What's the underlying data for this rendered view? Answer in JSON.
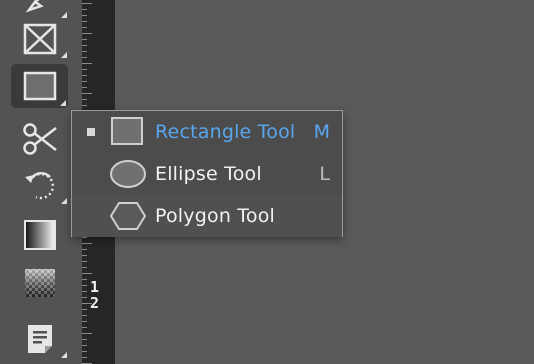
{
  "toolbar": {
    "tools": [
      {
        "name": "pen-tool",
        "icon": "pen-icon"
      },
      {
        "name": "rectangle-frame-tool",
        "icon": "frame-x-icon"
      },
      {
        "name": "rectangle-tool",
        "icon": "rectangle-icon",
        "selected": true
      },
      {
        "name": "scissors-tool",
        "icon": "scissors-icon"
      },
      {
        "name": "free-transform-tool",
        "icon": "rotate-icon"
      },
      {
        "name": "gradient-swatch-tool",
        "icon": "gradient-icon"
      },
      {
        "name": "gradient-feather-tool",
        "icon": "checker-icon"
      },
      {
        "name": "note-tool",
        "icon": "note-icon"
      }
    ]
  },
  "ruler": {
    "label_line1": "1",
    "label_line2": "2"
  },
  "flyout": {
    "items": [
      {
        "label": "Rectangle Tool",
        "shortcut": "M",
        "icon": "rectangle-icon",
        "active": true
      },
      {
        "label": "Ellipse Tool",
        "shortcut": "L",
        "icon": "ellipse-icon",
        "active": false
      },
      {
        "label": "Polygon Tool",
        "shortcut": "",
        "icon": "polygon-icon",
        "active": false
      }
    ]
  },
  "colors": {
    "active_text": "#58a6ee",
    "panel": "#535353",
    "ruler": "#262626"
  }
}
